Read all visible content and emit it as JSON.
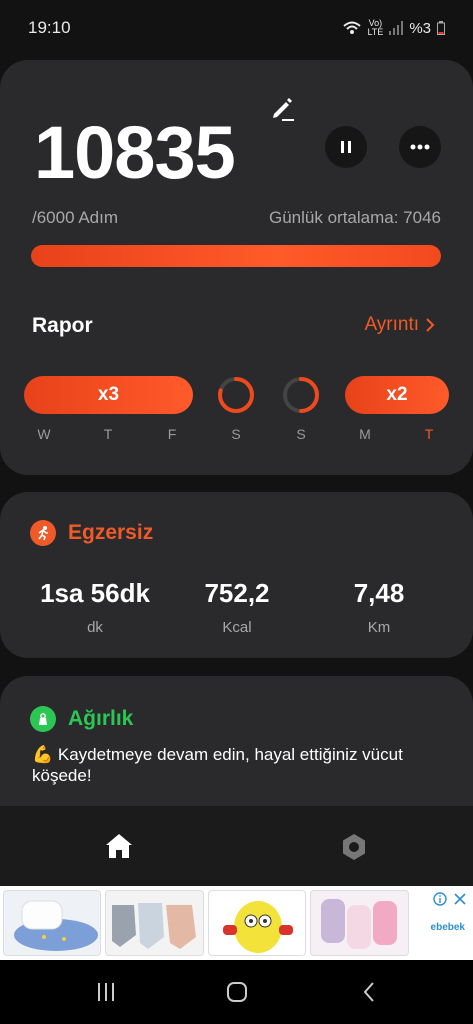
{
  "status_bar": {
    "time": "19:10",
    "network_top": "Vo)",
    "network_bottom": "LTE",
    "battery": "%3"
  },
  "steps": {
    "count": "10835",
    "goal": "/6000 Adım",
    "daily_average": "Günlük ortalama: 7046",
    "progress_percent": 100
  },
  "report": {
    "title": "Rapor",
    "details_label": "Ayrıntı"
  },
  "streaks": {
    "pill_1": "x3",
    "pill_2": "x2",
    "days": [
      "W",
      "T",
      "F",
      "S",
      "S",
      "M",
      "T"
    ]
  },
  "exercise": {
    "title": "Egzersiz",
    "metrics": [
      {
        "value": "1sa 56dk",
        "unit": "dk"
      },
      {
        "value": "752,2",
        "unit": "Kcal"
      },
      {
        "value": "7,48",
        "unit": "Km"
      }
    ]
  },
  "weight": {
    "title": "Ağırlık",
    "message": "💪 Kaydetmeye devam edin, hayal ettiğiniz vücut köşede!"
  },
  "ad": {
    "brand": "ebebek"
  },
  "colors": {
    "accent": "#f05a28",
    "green": "#2cc655",
    "card": "#2a2a2c",
    "background": "#121212"
  }
}
